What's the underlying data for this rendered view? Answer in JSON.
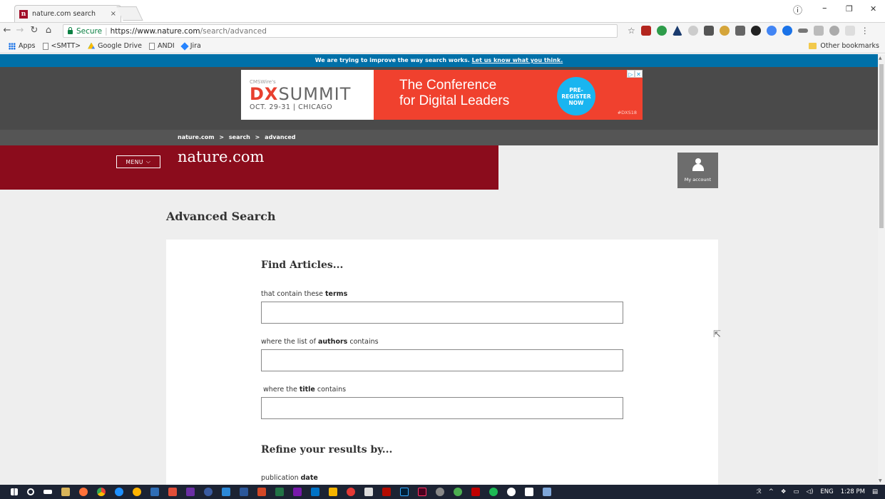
{
  "browser": {
    "tab_title": "nature.com search",
    "tab_close": "×",
    "window_controls": {
      "account": "ⓘ",
      "minimize": "–",
      "restore": "❐",
      "close": "✕"
    },
    "url_secure": "Secure",
    "url_host": "https://www.nature.com",
    "url_path": "/search/advanced",
    "bookmarks": [
      "Apps",
      "<SMTT>",
      "Google Drive",
      "ANDI",
      "Jira"
    ],
    "other_bookmarks": "Other bookmarks"
  },
  "notice": {
    "text": "We are trying to improve the way search works.",
    "link": "Let us know what you think."
  },
  "ad": {
    "brand_small": "CMSWire's",
    "logo_dx": "DX",
    "logo_summit": "SUMMIT",
    "date": "OCT. 29-31 | CHICAGO",
    "headline_1": "The Conference",
    "headline_2": "for Digital Leaders",
    "badge_1": "PRE-",
    "badge_2": "REGISTER",
    "badge_3": "NOW",
    "hashtag": "#DXS18"
  },
  "breadcrumb": {
    "items": [
      "nature.com",
      "search",
      "advanced"
    ],
    "separator": ">"
  },
  "header": {
    "menu_label": "MENU",
    "logo": "nature.com",
    "account_label": "My account"
  },
  "page": {
    "title": "Advanced Search"
  },
  "form": {
    "section_find": "Find Articles...",
    "terms_label_pre": "that contain these ",
    "terms_label_bold": "terms",
    "authors_label_pre": "where the list of ",
    "authors_label_bold": "authors",
    "authors_label_post": " contains",
    "title_label_pre": " where the ",
    "title_label_bold": "title",
    "title_label_post": " contains",
    "section_refine": "Refine your results by...",
    "date_label_pre": "publication ",
    "date_label_bold": "date",
    "terms_value": "",
    "authors_value": "",
    "title_value": ""
  },
  "taskbar": {
    "language": "ENG",
    "time": "1:28 PM"
  },
  "colors": {
    "nature_red": "#8b0c1c",
    "notice_blue": "#0070a8",
    "ad_red": "#f0412e",
    "ad_badge": "#19b5f0"
  }
}
